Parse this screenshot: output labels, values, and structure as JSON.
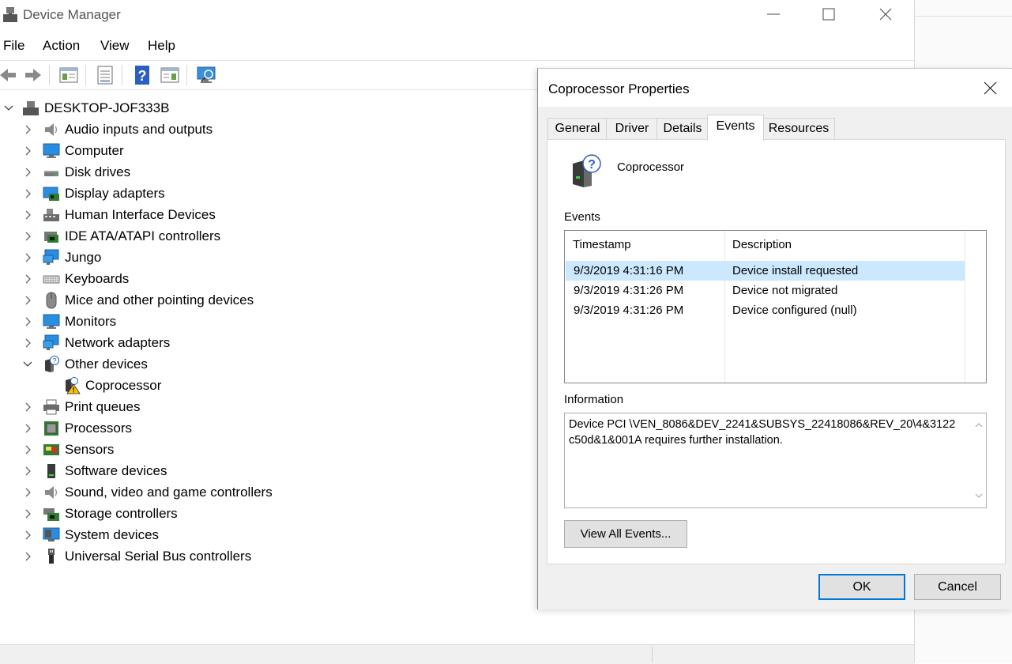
{
  "window": {
    "title": "Device Manager",
    "menu": [
      "File",
      "Action",
      "View",
      "Help"
    ]
  },
  "tree": {
    "root": "DESKTOP-JOF333B",
    "items": [
      {
        "label": "Audio inputs and outputs",
        "icon": "speaker-icon"
      },
      {
        "label": "Computer",
        "icon": "monitor-icon"
      },
      {
        "label": "Disk drives",
        "icon": "disk-drive-icon"
      },
      {
        "label": "Display adapters",
        "icon": "display-adapter-icon"
      },
      {
        "label": "Human Interface Devices",
        "icon": "hid-icon"
      },
      {
        "label": "IDE ATA/ATAPI controllers",
        "icon": "ide-controller-icon"
      },
      {
        "label": "Jungo",
        "icon": "network-monitor-icon"
      },
      {
        "label": "Keyboards",
        "icon": "keyboard-icon"
      },
      {
        "label": "Mice and other pointing devices",
        "icon": "mouse-icon"
      },
      {
        "label": "Monitors",
        "icon": "monitor-icon"
      },
      {
        "label": "Network adapters",
        "icon": "network-monitor-icon"
      },
      {
        "label": "Other devices",
        "icon": "unknown-device-icon",
        "expanded": true
      },
      {
        "label": "Coprocessor",
        "icon": "warning-device-icon",
        "child": true
      },
      {
        "label": "Print queues",
        "icon": "printer-icon"
      },
      {
        "label": "Processors",
        "icon": "processor-icon"
      },
      {
        "label": "Sensors",
        "icon": "sensor-icon"
      },
      {
        "label": "Software devices",
        "icon": "software-device-icon"
      },
      {
        "label": "Sound, video and game controllers",
        "icon": "speaker-icon"
      },
      {
        "label": "Storage controllers",
        "icon": "storage-controller-icon"
      },
      {
        "label": "System devices",
        "icon": "system-devices-icon"
      },
      {
        "label": "Universal Serial Bus controllers",
        "icon": "usb-icon"
      }
    ]
  },
  "dialog": {
    "title": "Coprocessor Properties",
    "tabs": [
      "General",
      "Driver",
      "Details",
      "Events",
      "Resources"
    ],
    "active_tab": "Events",
    "device_name": "Coprocessor",
    "events_label": "Events",
    "columns": {
      "timestamp": "Timestamp",
      "description": "Description"
    },
    "events": [
      {
        "timestamp": "9/3/2019 4:31:16 PM",
        "description": "Device install requested",
        "selected": true
      },
      {
        "timestamp": "9/3/2019 4:31:26 PM",
        "description": "Device not migrated"
      },
      {
        "timestamp": "9/3/2019 4:31:26 PM",
        "description": "Device configured (null)"
      }
    ],
    "information_label": "Information",
    "information_text": "Device PCI \\VEN_8086&DEV_2241&SUBSYS_22418086&REV_20\\4&3122c50d&1&001A requires further installation.",
    "view_all_button": "View All Events...",
    "ok_button": "OK",
    "cancel_button": "Cancel"
  },
  "colors": {
    "selection": "#cce8ff",
    "default_button_border": "#0078d7",
    "dialog_background": "#f0f0f0"
  }
}
